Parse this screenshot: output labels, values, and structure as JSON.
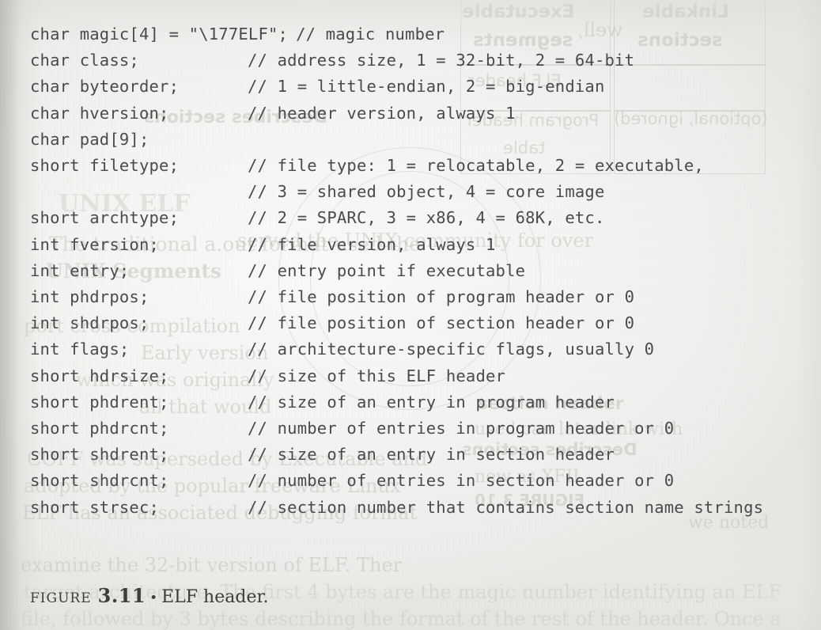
{
  "page": {
    "background_color": "#f4f3f1",
    "text_color": "#4a4a4a"
  },
  "figure": {
    "label_word": "FIGURE",
    "number": "3.11",
    "separator": "•",
    "title": "ELF header."
  },
  "code": {
    "language": "c",
    "lines": [
      {
        "decl": "char magic[4] = \"\\177ELF\";",
        "comment": "// magic number",
        "inline": true
      },
      {
        "decl": "char class;",
        "comment": "// address size, 1 = 32-bit, 2 = 64-bit"
      },
      {
        "decl": "char byteorder;",
        "comment": "// 1 = little-endian, 2 = big-endian"
      },
      {
        "decl": "char hversion;",
        "comment": "// header version, always 1"
      },
      {
        "decl": "char pad[9];",
        "comment": ""
      },
      {
        "decl": "short filetype;",
        "comment": "// file type: 1 = relocatable, 2 = executable,"
      },
      {
        "decl": "",
        "comment": "// 3 = shared object, 4 = core image"
      },
      {
        "decl": "short archtype;",
        "comment": "// 2 = SPARC, 3 = x86, 4 = 68K, etc."
      },
      {
        "decl": "int fversion;",
        "comment": "// file version, always 1"
      },
      {
        "decl": "int entry;",
        "comment": "// entry point if executable"
      },
      {
        "decl": "int phdrpos;",
        "comment": "// file position of program header or 0"
      },
      {
        "decl": "int shdrpos;",
        "comment": "// file position of section header or 0"
      },
      {
        "decl": "int flags;",
        "comment": "// architecture-specific flags, usually 0"
      },
      {
        "decl": "short hdrsize;",
        "comment": "// size of this ELF header"
      },
      {
        "decl": "short phdrent;",
        "comment": "// size of an entry in program header"
      },
      {
        "decl": "short phdrcnt;",
        "comment": "// number of entries in program header or 0"
      },
      {
        "decl": "short shdrent;",
        "comment": "// size of an entry in section header"
      },
      {
        "decl": "short shdrcnt;",
        "comment": "// number of entries in section header or 0"
      },
      {
        "decl": "short strsec;",
        "comment": "// section number that contains section name strings"
      }
    ]
  },
  "bleed_through": {
    "description": "faint show-through text from the facing and reverse book pages",
    "color": "#b9b6b0",
    "fragments": [
      {
        "text": "Executable",
        "mirrored": false
      },
      {
        "text": "segments",
        "mirrored": false
      },
      {
        "text": "Linkable",
        "mirrored": true
      },
      {
        "text": "sections",
        "mirrored": true
      },
      {
        "text": "well,",
        "mirrored": false
      },
      {
        "text": "ELF header",
        "mirrored": true
      },
      {
        "text": "(optional, ignored)",
        "mirrored": true
      },
      {
        "text": "table",
        "mirrored": true
      },
      {
        "text": "Program header",
        "mirrored": true
      },
      {
        "text": "Describes sections",
        "mirrored": false
      },
      {
        "text": "UNIX  ELF",
        "mirrored": false
      },
      {
        "text": "The traditional a.out format used the",
        "mirrored": false
      },
      {
        "text": "UNIX  Segments",
        "mirrored": false
      },
      {
        "text": "served the UNIX community for over",
        "mirrored": false
      },
      {
        "text": "port cross-compilation",
        "mirrored": false
      },
      {
        "text": "Early version",
        "mirrored": false
      },
      {
        "text": "which was originally",
        "mirrored": false
      },
      {
        "text": "all that would",
        "mirrored": false
      },
      {
        "text": "section header",
        "mirrored": false
      },
      {
        "text": "COFF was superseded by Executable and",
        "mirrored": false
      },
      {
        "text": "adopted by the popular freeware Linux",
        "mirrored": false
      },
      {
        "text": "ELF has an associated debugging format",
        "mirrored": false
      },
      {
        "text": "examine the 32-bit version of ELF. Ther",
        "mirrored": false
      },
      {
        "text": "target architecture. The first 4 bytes are the magic number identifying an ELF",
        "mirrored": false
      },
      {
        "text": "file, followed by 3 bytes describing the format of the rest of the header. Once a",
        "mirrored": false
      },
      {
        "text": "FIGURE  3.10",
        "mirrored": true
      },
      {
        "text": "Describes sections",
        "mirrored": true
      },
      {
        "text": "used can later link with",
        "mirrored": false
      },
      {
        "text": "new as XFIL",
        "mirrored": false
      },
      {
        "text": "we noted",
        "mirrored": false
      }
    ]
  }
}
